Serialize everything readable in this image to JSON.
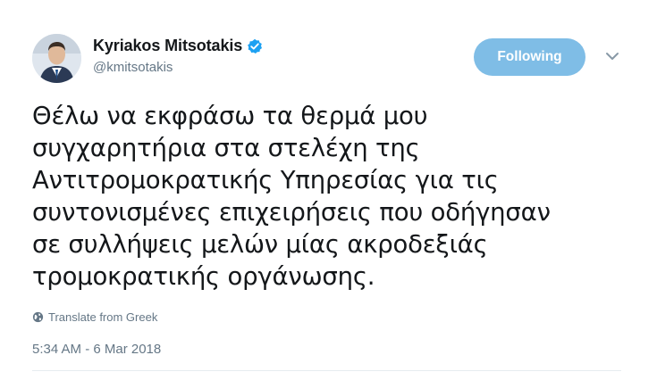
{
  "author": {
    "display_name": "Kyriakos Mitsotakis",
    "handle": "@kmitsotakis",
    "verified": true
  },
  "actions": {
    "follow_label": "Following",
    "follow_color": "#7fbde6",
    "more_icon": "chevron-down-icon"
  },
  "tweet": {
    "lines": [
      "Θέλω να εκφράσω τα θερμά μου",
      "συγχαρητήρια στα στελέχη της",
      "Αντιτρομοκρατικής Υπηρεσίας για τις",
      "συντονισμένες επιχειρήσεις που οδήγησαν",
      "σε συλλήψεις μελών μίας ακροδεξιάς",
      "τρομοκρατικής οργάνωσης."
    ],
    "translate_label": "Translate from Greek",
    "timestamp": "5:34 AM - 6 Mar 2018"
  },
  "colors": {
    "verified_badge": "#1da1f2",
    "secondary_text": "#657786"
  }
}
